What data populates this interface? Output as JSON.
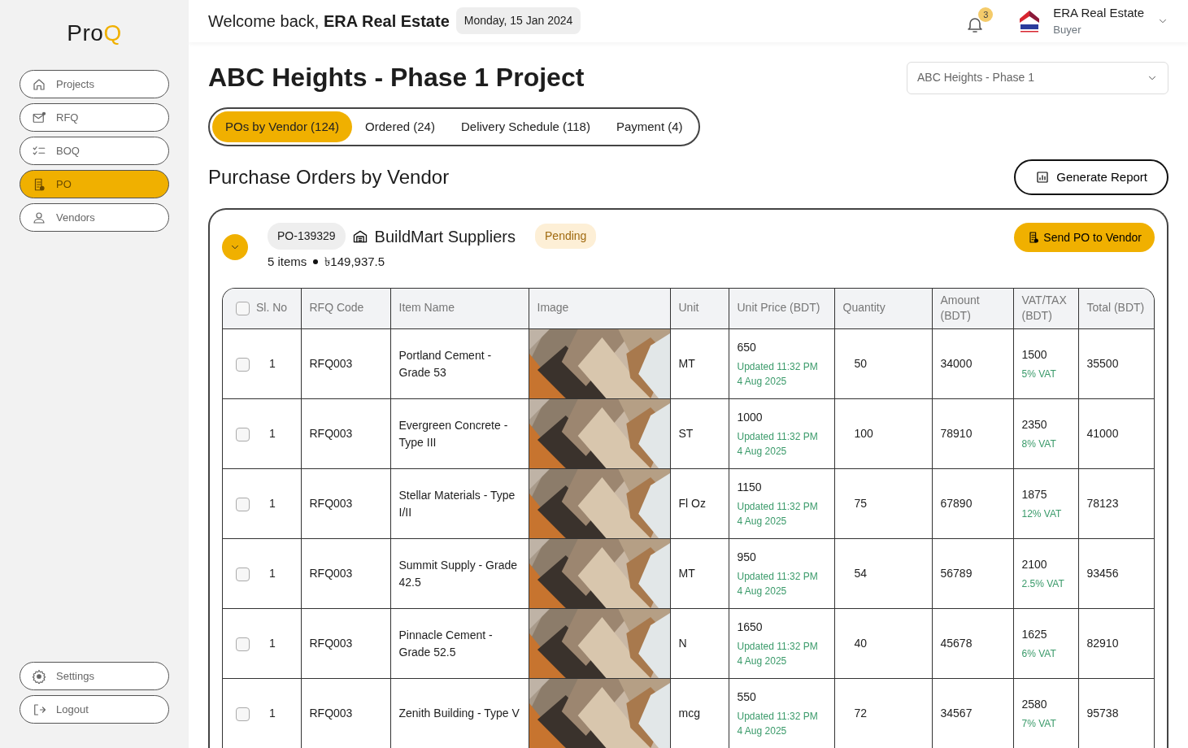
{
  "logo": {
    "text": "Pro",
    "accent": "Q"
  },
  "sidebar": {
    "items": [
      {
        "label": "Projects",
        "selected": false
      },
      {
        "label": "RFQ",
        "selected": false
      },
      {
        "label": "BOQ",
        "selected": false
      },
      {
        "label": "PO",
        "selected": true
      },
      {
        "label": "Vendors",
        "selected": false
      }
    ],
    "bottom_items": [
      {
        "label": "Settings"
      },
      {
        "label": "Logout"
      }
    ]
  },
  "header": {
    "welcome": "Welcome back, **ERA Real Estate**",
    "date": "Monday, 15 Jan 2024",
    "notifications": "3",
    "user_name": "ERA Real Estate",
    "user_role": "Buyer"
  },
  "page": {
    "title": "ABC Heights - Phase 1 Project",
    "project_select": "ABC Heights - Phase 1"
  },
  "tabs": [
    {
      "label": "POs by Vendor (124)",
      "selected": true
    },
    {
      "label": "Ordered (24)",
      "selected": false
    },
    {
      "label": "Delivery Schedule (118)",
      "selected": false
    },
    {
      "label": "Payment (4)",
      "selected": false
    }
  ],
  "section": {
    "title": "Purchase Orders by Vendor",
    "report_button": "Generate Report"
  },
  "po": {
    "expanded": true,
    "number": "PO-139329",
    "vendor": "BuildMart Suppliers",
    "status": "Pending",
    "items": "5 items",
    "total": "৳149,937.5",
    "send_button": "Send PO to Vendor"
  },
  "table": {
    "all_checked": false,
    "columns": [
      "Sl. No",
      "RFQ Code",
      "Item Name",
      "Image",
      "Unit",
      "Unit Price (BDT)",
      "Quantity",
      "Amount (BDT)",
      "VAT/TAX (BDT)",
      "Total (BDT)"
    ],
    "rows": [
      {
        "checked": false,
        "sl": "1",
        "rfq": "RFQ003",
        "item": "Portland Cement - Grade 53",
        "unit": "MT",
        "price": "650",
        "updated": "Updated 11:32 PM 4 Aug 2025",
        "qty": "50",
        "amount": "34000",
        "vat": "1500",
        "vat_rate": "5% VAT",
        "total": "35500"
      },
      {
        "checked": false,
        "sl": "1",
        "rfq": "RFQ003",
        "item": "Evergreen Concrete - Type III",
        "unit": "ST",
        "price": "1000",
        "updated": "Updated 11:32 PM 4 Aug 2025",
        "qty": "100",
        "amount": "78910",
        "vat": "2350",
        "vat_rate": "8% VAT",
        "total": "41000"
      },
      {
        "checked": false,
        "sl": "1",
        "rfq": "RFQ003",
        "item": "Stellar Materials - Type I/II",
        "unit": "Fl Oz",
        "price": "1150",
        "updated": "Updated 11:32 PM 4 Aug 2025",
        "qty": "75",
        "amount": "67890",
        "vat": "1875",
        "vat_rate": "12% VAT",
        "total": "78123"
      },
      {
        "checked": false,
        "sl": "1",
        "rfq": "RFQ003",
        "item": "Summit Supply - Grade 42.5",
        "unit": "MT",
        "price": "950",
        "updated": "Updated 11:32 PM 4 Aug 2025",
        "qty": "54",
        "amount": "56789",
        "vat": "2100",
        "vat_rate": "2.5% VAT",
        "total": "93456"
      },
      {
        "checked": false,
        "sl": "1",
        "rfq": "RFQ003",
        "item": "Pinnacle Cement - Grade 52.5",
        "unit": "N",
        "price": "1650",
        "updated": "Updated 11:32 PM 4 Aug 2025",
        "qty": "40",
        "amount": "45678",
        "vat": "1625",
        "vat_rate": "6% VAT",
        "total": "82910"
      },
      {
        "checked": false,
        "sl": "1",
        "rfq": "RFQ003",
        "item": "Zenith Building - Type V",
        "unit": "mcg",
        "price": "550",
        "updated": "Updated 11:32 PM 4 Aug 2025",
        "qty": "72",
        "amount": "34567",
        "vat": "2580",
        "vat_rate": "7% VAT",
        "total": "95738"
      }
    ]
  }
}
